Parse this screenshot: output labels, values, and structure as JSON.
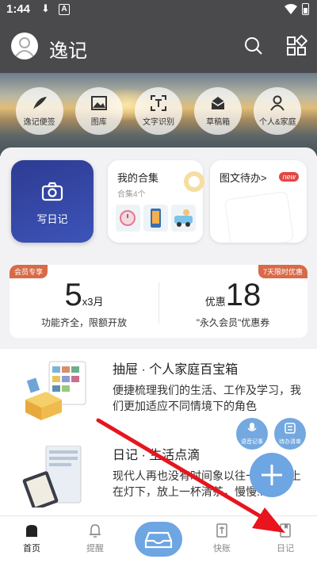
{
  "status": {
    "time": "1:44",
    "download": "⬇",
    "badge": "A"
  },
  "appbar": {
    "title": "逸记"
  },
  "quick_actions": [
    {
      "label": "逸记便签",
      "icon": "feather-icon"
    },
    {
      "label": "图库",
      "icon": "image-icon"
    },
    {
      "label": "文字识别",
      "icon": "text-scan-icon"
    },
    {
      "label": "草稿箱",
      "icon": "drafts-icon"
    },
    {
      "label": "个人&家庭",
      "icon": "person-icon"
    }
  ],
  "write_diary": {
    "label": "写日记"
  },
  "collection": {
    "title": "我的合集",
    "subtitle": "合集4个"
  },
  "todo": {
    "title": "图文待办>",
    "badge": "new"
  },
  "vip": {
    "tag_left": "会员专享",
    "tag_right": "7天限时优惠",
    "left_big": "5",
    "left_unit": "x3月",
    "left_desc": "功能齐全，限额开放",
    "right_prefix": "优惠",
    "right_big": "18",
    "right_desc": "\"永久会员\"优惠券"
  },
  "features": [
    {
      "title": "抽屉 · 个人家庭百宝箱",
      "desc": "便捷梳理我们的生活、工作及学习，我们更加适应不同情境下的角色"
    },
    {
      "title": "日记 · 生活点滴",
      "desc": "现代人再也没有时间象以往一样，晚上在灯下，放上一杯清茶，慢慢..."
    }
  ],
  "fab_small": [
    {
      "label": "语音记事",
      "icon": "microphone-icon"
    },
    {
      "label": "待办清单",
      "icon": "checklist-icon"
    }
  ],
  "nav": [
    {
      "label": "首页"
    },
    {
      "label": "提醒"
    },
    {
      "label": "快账"
    },
    {
      "label": "日记"
    }
  ],
  "colors": {
    "accent": "#6ea5e3",
    "header": "#4a4a4c",
    "write_card": "#2d3b93",
    "arrow": "#e8141e"
  }
}
